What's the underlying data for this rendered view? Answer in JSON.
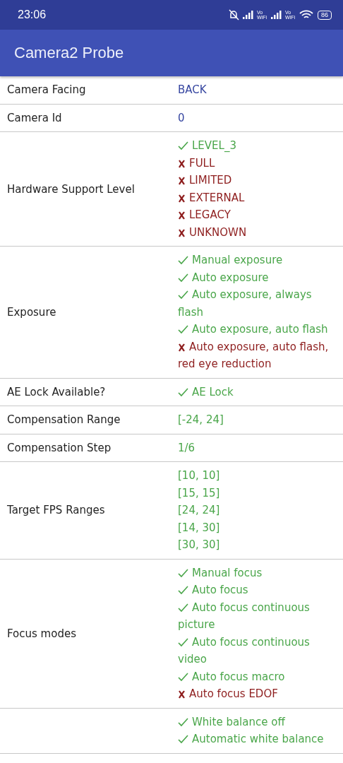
{
  "status_bar": {
    "time": "23:06",
    "network_labels": [
      "Vo WiFi",
      "Vo WiFi"
    ],
    "battery": "86"
  },
  "app_bar": {
    "title": "Camera2 Probe"
  },
  "rows": [
    {
      "label": "Camera Facing",
      "values": [
        {
          "kind": "info",
          "text": "BACK"
        }
      ]
    },
    {
      "label": "Camera Id",
      "values": [
        {
          "kind": "info",
          "text": "0"
        }
      ]
    },
    {
      "label": "Hardware Support Level",
      "values": [
        {
          "kind": "supported",
          "text": "LEVEL_3"
        },
        {
          "kind": "unsupported",
          "text": "FULL"
        },
        {
          "kind": "unsupported",
          "text": "LIMITED"
        },
        {
          "kind": "unsupported",
          "text": "EXTERNAL"
        },
        {
          "kind": "unsupported",
          "text": "LEGACY"
        },
        {
          "kind": "unsupported",
          "text": "UNKNOWN"
        }
      ]
    },
    {
      "label": "Exposure",
      "values": [
        {
          "kind": "supported",
          "text": "Manual exposure"
        },
        {
          "kind": "supported",
          "text": "Auto exposure"
        },
        {
          "kind": "supported",
          "text": "Auto exposure, always flash"
        },
        {
          "kind": "supported",
          "text": "Auto exposure, auto flash"
        },
        {
          "kind": "unsupported",
          "text": "Auto exposure, auto flash, red eye reduction"
        }
      ]
    },
    {
      "label": "AE Lock Available?",
      "values": [
        {
          "kind": "supported",
          "text": "AE Lock"
        }
      ]
    },
    {
      "label": "Compensation Range",
      "values": [
        {
          "kind": "value",
          "text": "[-24, 24]"
        }
      ]
    },
    {
      "label": "Compensation Step",
      "values": [
        {
          "kind": "value",
          "text": "1/6"
        }
      ]
    },
    {
      "label": "Target FPS Ranges",
      "values": [
        {
          "kind": "value",
          "text": "[10, 10]"
        },
        {
          "kind": "value",
          "text": "[15, 15]"
        },
        {
          "kind": "value",
          "text": "[24, 24]"
        },
        {
          "kind": "value",
          "text": "[14, 30]"
        },
        {
          "kind": "value",
          "text": "[30, 30]"
        }
      ]
    },
    {
      "label": "Focus modes",
      "values": [
        {
          "kind": "supported",
          "text": "Manual focus"
        },
        {
          "kind": "supported",
          "text": "Auto focus"
        },
        {
          "kind": "supported",
          "text": "Auto focus continuous picture"
        },
        {
          "kind": "supported",
          "text": "Auto focus continuous video"
        },
        {
          "kind": "supported",
          "text": "Auto focus macro"
        },
        {
          "kind": "unsupported",
          "text": "Auto focus EDOF"
        }
      ]
    },
    {
      "values": [
        {
          "kind": "supported",
          "text": "White balance off"
        },
        {
          "kind": "supported",
          "text": "Automatic white balance"
        }
      ]
    }
  ]
}
